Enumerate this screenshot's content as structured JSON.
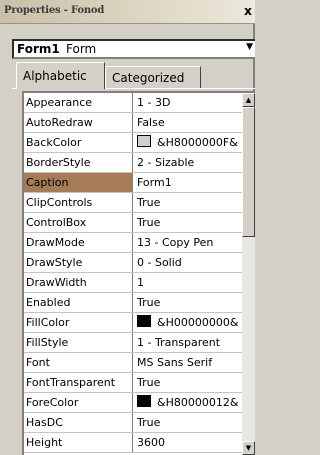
{
  "window": {
    "title": "Properties - Fonod",
    "close_label": "x"
  },
  "object_combo": {
    "name": "Form1",
    "type": "Form",
    "arrow": "▼"
  },
  "tabs": [
    {
      "label": "Alphabetic",
      "active": true
    },
    {
      "label": "Categorized",
      "active": false
    }
  ],
  "properties": [
    {
      "name": "Appearance",
      "value": "1 - 3D"
    },
    {
      "name": "AutoRedraw",
      "value": "False"
    },
    {
      "name": "BackColor",
      "value": "&H8000000F&",
      "swatch": "#d4d0c8"
    },
    {
      "name": "BorderStyle",
      "value": "2 - Sizable"
    },
    {
      "name": "Caption",
      "value": "Form1",
      "selected": true
    },
    {
      "name": "ClipControls",
      "value": "True"
    },
    {
      "name": "ControlBox",
      "value": "True"
    },
    {
      "name": "DrawMode",
      "value": "13 - Copy Pen"
    },
    {
      "name": "DrawStyle",
      "value": "0 - Solid"
    },
    {
      "name": "DrawWidth",
      "value": "1"
    },
    {
      "name": "Enabled",
      "value": "True"
    },
    {
      "name": "FillColor",
      "value": "&H00000000&",
      "swatch": "#000000"
    },
    {
      "name": "FillStyle",
      "value": "1 - Transparent"
    },
    {
      "name": "Font",
      "value": "MS Sans Serif"
    },
    {
      "name": "FontTransparent",
      "value": "True"
    },
    {
      "name": "ForeColor",
      "value": "&H80000012&",
      "swatch": "#000000"
    },
    {
      "name": "HasDC",
      "value": "True"
    },
    {
      "name": "Height",
      "value": "3600"
    }
  ],
  "scrollbar": {
    "up_icon": "▲",
    "down_icon": "▼"
  }
}
